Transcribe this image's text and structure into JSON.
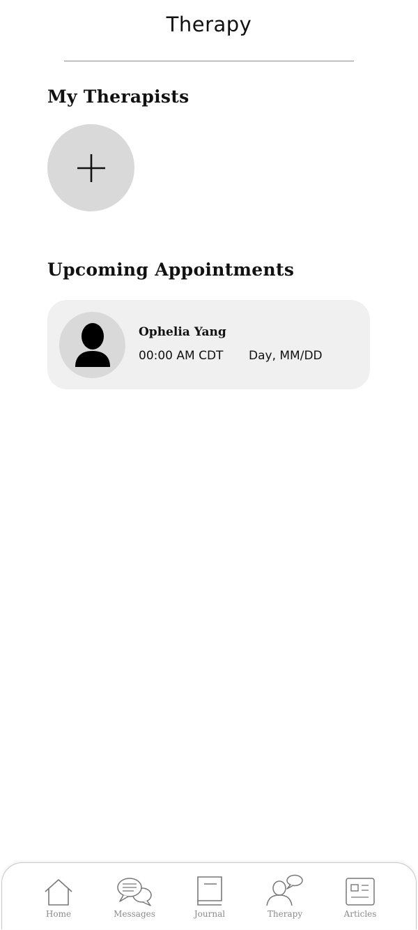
{
  "header": {
    "title": "Therapy"
  },
  "therapists": {
    "section_title": "My Therapists",
    "add_icon": "plus-icon"
  },
  "appointments": {
    "section_title": "Upcoming Appointments",
    "items": [
      {
        "name": "Ophelia Yang",
        "time": "00:00 AM CDT",
        "date": "Day, MM/DD",
        "avatar_icon": "person-icon"
      }
    ]
  },
  "nav": {
    "items": [
      {
        "label": "Home",
        "icon": "home-icon"
      },
      {
        "label": "Messages",
        "icon": "chat-bubbles-icon"
      },
      {
        "label": "Journal",
        "icon": "book-icon"
      },
      {
        "label": "Therapy",
        "icon": "therapist-icon"
      },
      {
        "label": "Articles",
        "icon": "newspaper-icon"
      }
    ]
  },
  "colors": {
    "circle_fill": "#d9d9d9",
    "card_fill": "#f0f0f0",
    "nav_label": "#8a8a8a"
  }
}
